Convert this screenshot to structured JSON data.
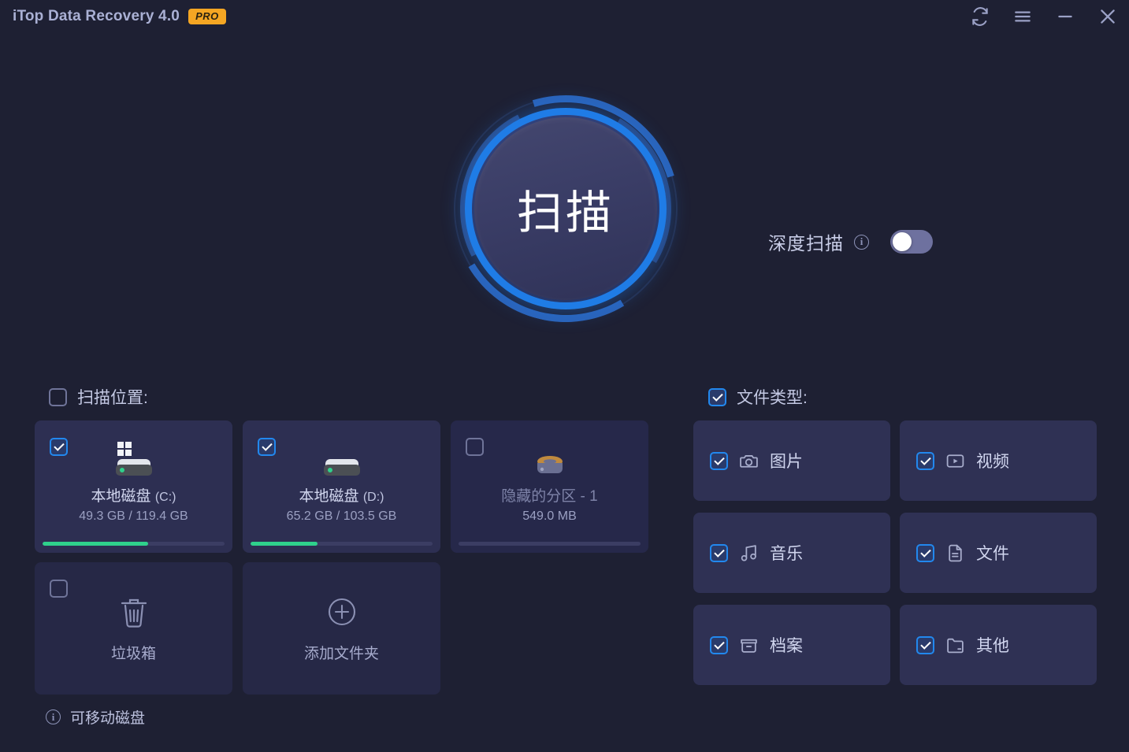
{
  "titlebar": {
    "title": "iTop Data Recovery 4.0",
    "badge": "PRO",
    "buttons": [
      {
        "name": "refresh-icon",
        "label": "刷新"
      },
      {
        "name": "menu-icon",
        "label": "菜单"
      },
      {
        "name": "minimize-icon",
        "label": "最小化"
      },
      {
        "name": "close-icon",
        "label": "关闭"
      }
    ]
  },
  "scan": {
    "button_label": "扫描"
  },
  "deep_scan": {
    "label": "深度扫描",
    "info": "i",
    "enabled": false
  },
  "scan_location": {
    "header_label": "扫描位置:",
    "header_checked": false,
    "cards": [
      {
        "name": "本地磁盘",
        "drive": "(C:)",
        "size": "49.3 GB / 119.4 GB",
        "checked": true,
        "used_percent": 58,
        "icon": "windows-drive-icon"
      },
      {
        "name": "本地磁盘",
        "drive": "(D:)",
        "size": "65.2 GB / 103.5 GB",
        "checked": true,
        "used_percent": 37,
        "icon": "drive-icon"
      },
      {
        "name": "隐藏的分区 - 1",
        "drive": "",
        "size": "549.0 MB",
        "checked": false,
        "used_percent": 0,
        "icon": "hidden-partition-icon"
      }
    ],
    "recycle_bin": {
      "label": "垃圾箱",
      "checked": false,
      "icon": "trash-icon"
    },
    "add_folder": {
      "label": "添加文件夹",
      "icon": "plus-circle-icon"
    },
    "removable_hint": {
      "label": "可移动磁盘",
      "info": "i"
    }
  },
  "file_type": {
    "header_label": "文件类型:",
    "header_checked": true,
    "items": [
      {
        "label": "图片",
        "icon": "camera-icon",
        "checked": true
      },
      {
        "label": "视频",
        "icon": "video-icon",
        "checked": true
      },
      {
        "label": "音乐",
        "icon": "music-icon",
        "checked": true
      },
      {
        "label": "文件",
        "icon": "document-icon",
        "checked": true
      },
      {
        "label": "档案",
        "icon": "archive-icon",
        "checked": true
      },
      {
        "label": "其他",
        "icon": "folder-icon",
        "checked": true
      }
    ]
  },
  "colors": {
    "background": "#1e2033",
    "card": "#2f3154",
    "accent_blue": "#1f7ce6",
    "badge_orange": "#f5a623",
    "progress_green": "#2fd18c",
    "text_primary": "#d1d6ef"
  }
}
